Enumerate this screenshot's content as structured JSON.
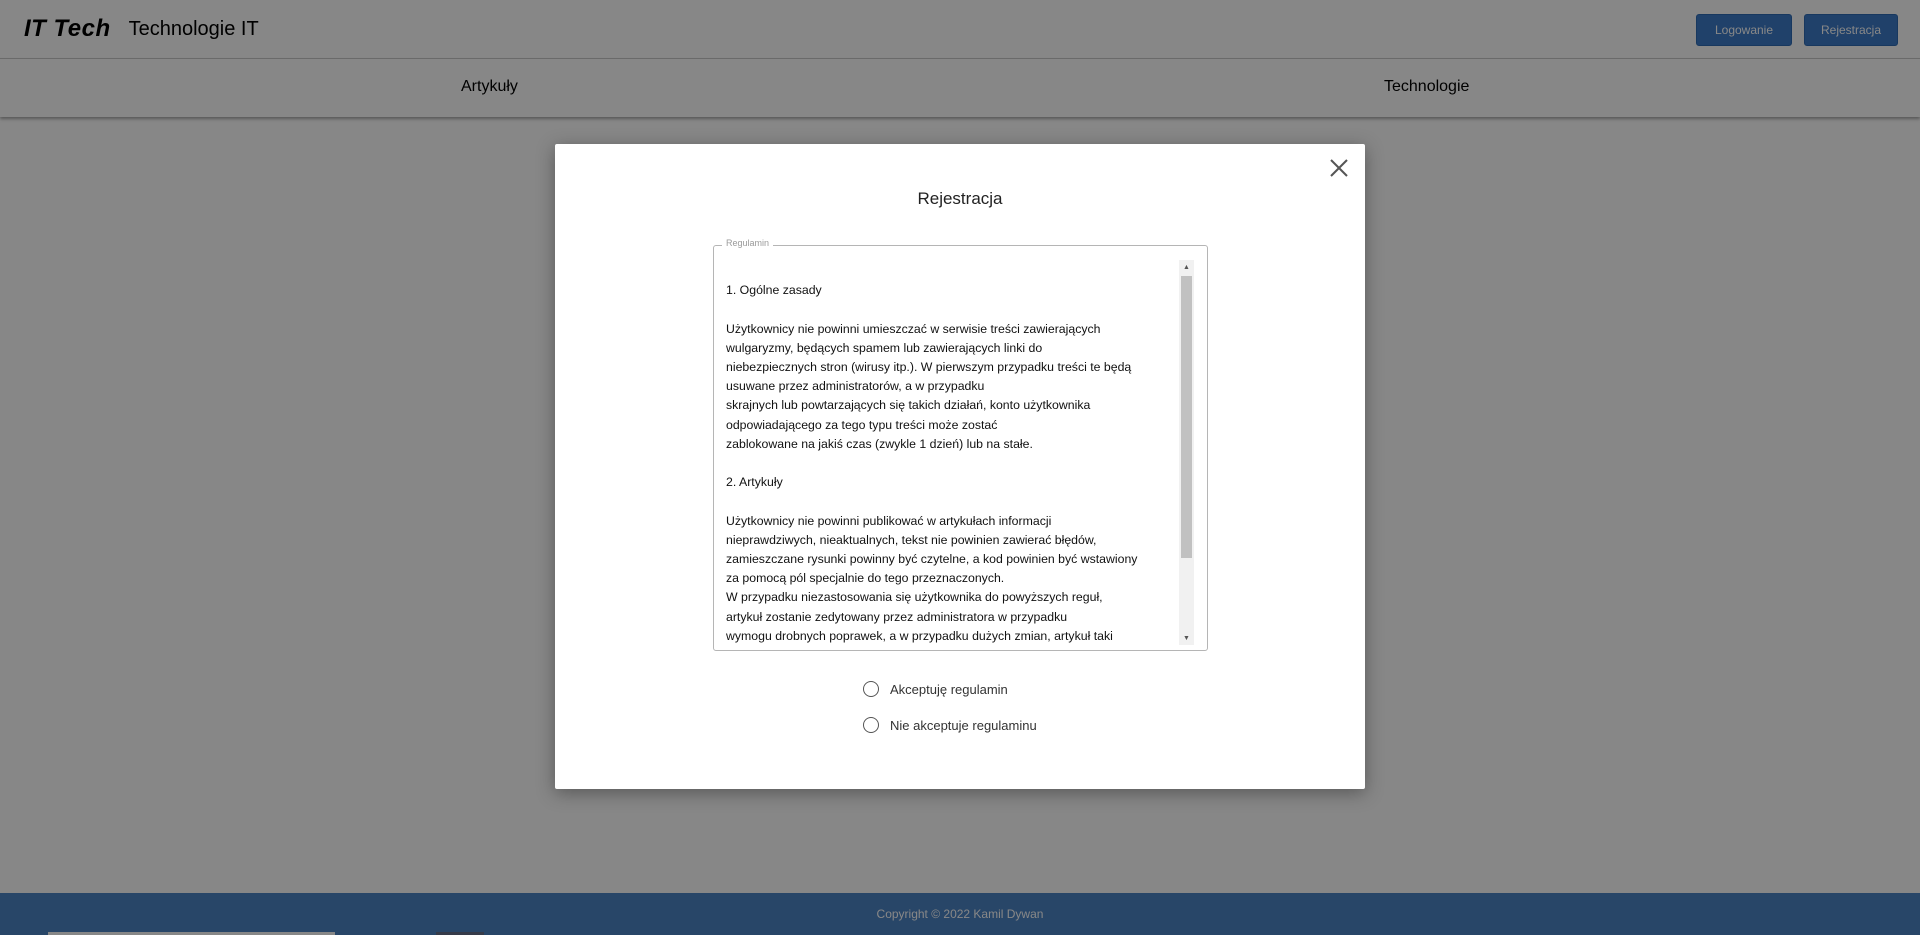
{
  "header": {
    "logo": "IT Tech",
    "site_title": "Technologie IT",
    "login_label": "Logowanie",
    "register_label": "Rejestracja"
  },
  "nav": {
    "items": [
      {
        "label": "Artykuły"
      },
      {
        "label": "Technologie"
      }
    ]
  },
  "footer": {
    "copyright": "Copyright © 2022 Kamil Dywan"
  },
  "modal": {
    "title": "Rejestracja",
    "close_icon": "close-icon",
    "terms": {
      "legend": "Regulamin",
      "text": "\n1. Ogólne zasady\n\nUżytkownicy nie powinni umieszczać w serwisie treści zawierających\nwulgaryzmy, będących spamem lub zawierających linki do\nniebezpiecznych stron (wirusy itp.). W pierwszym przypadku treści te będą\nusuwane przez administratorów, a w przypadku\nskrajnych lub powtarzających się takich działań, konto użytkownika\nodpowiadającego za tego typu treści może zostać\nzablokowane na jakiś czas (zwykle 1 dzień) lub na stałe.\n\n2. Artykuły\n\nUżytkownicy nie powinni publikować w artykułach informacji\nnieprawdziwych, nieaktualnych, tekst nie powinien zawierać błędów,\nzamieszczane rysunki powinny być czytelne, a kod powinien być wstawiony\nza pomocą pól specjalnie do tego przeznaczonych.\nW przypadku niezastosowania się użytkownika do powyższych reguł,\nartykuł zostanie zedytowany przez administratora w przypadku\nwymogu drobnych poprawek, a w przypadku dużych zmian, artykuł taki"
    },
    "radios": {
      "accept_label": "Akceptuję regulamin",
      "reject_label": "Nie akceptuje regulaminu"
    }
  },
  "colors": {
    "primary": "#3d7cc9",
    "footer": "#4d84c4",
    "overlay": "rgba(0,0,0,0.47)"
  }
}
